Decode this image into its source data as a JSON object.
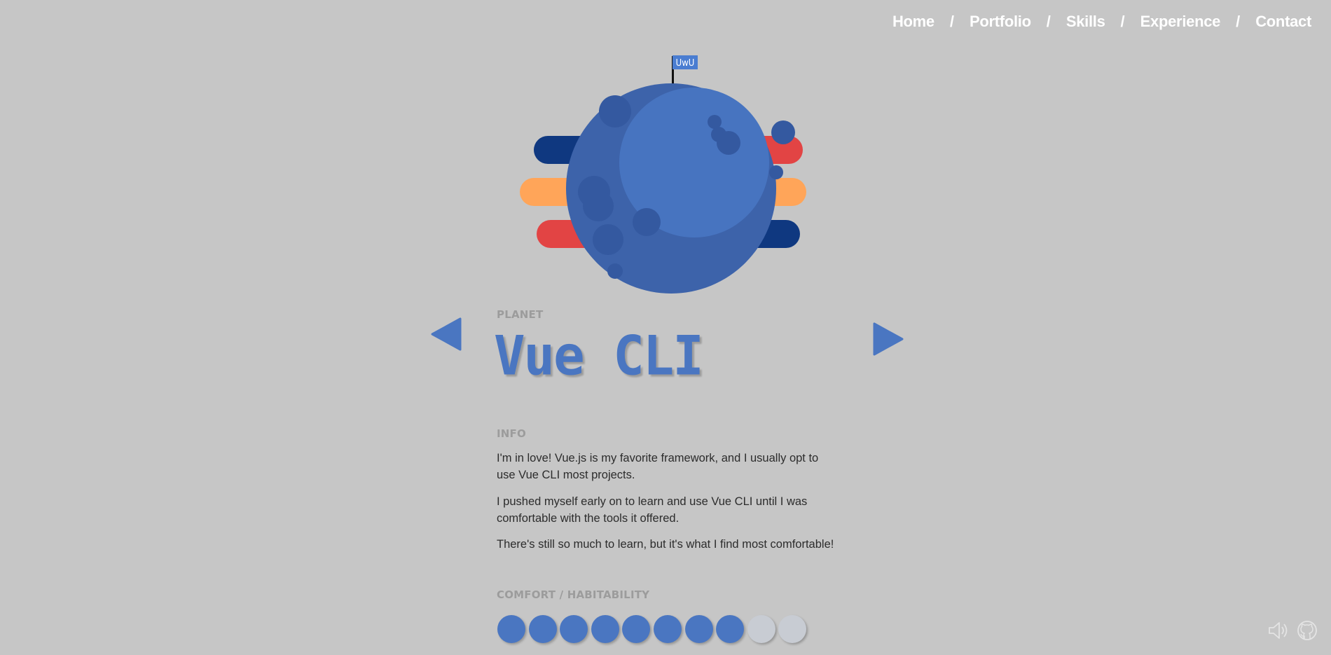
{
  "nav": {
    "items": [
      "Home",
      "Portfolio",
      "Skills",
      "Experience",
      "Contact"
    ],
    "separator": "/"
  },
  "planet": {
    "flag_text": "UwU",
    "colors": {
      "planet_dark": "#3d63aa",
      "planet_light": "#4774c0",
      "crater": "#3459a0",
      "ring_navy": "#0f3880",
      "ring_orange": "#ffa559",
      "ring_red": "#e24444",
      "flag": "#4a7dd1"
    }
  },
  "section": {
    "type_label": "PLANET",
    "title": "Vue CLI",
    "info_label": "INFO",
    "paragraphs": [
      "I'm in love! Vue.js is my favorite framework, and I usually opt to use Vue CLI most projects.",
      "I pushed myself early on to learn and use Vue CLI until I was comfortable with the tools it offered.",
      "There's still so much to learn, but it's what I find most comfortable!"
    ],
    "comfort_label": "COMFORT / HABITABILITY",
    "comfort_level": 8,
    "comfort_max": 10
  },
  "colors": {
    "background": "#c6c6c6",
    "accent": "#4a76c1",
    "dot_filled": "#4a76c1",
    "dot_empty": "#c8ccd3"
  },
  "icons": {
    "prev": "triangle-left-icon",
    "next": "triangle-right-icon",
    "sound": "speaker-icon",
    "github": "github-icon"
  }
}
